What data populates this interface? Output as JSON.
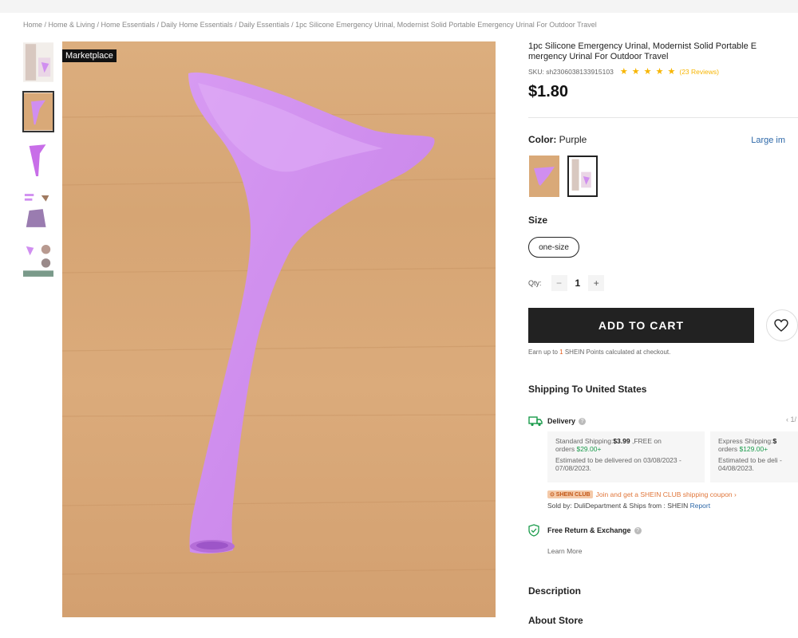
{
  "breadcrumb": "Home / Home & Living / Home Essentials / Daily Home Essentials / Daily Essentials / 1pc Silicone Emergency Urinal, Modernist Solid Portable Emergency Urinal For Outdoor Travel",
  "main_image": {
    "badge": "Marketplace"
  },
  "product": {
    "title": "1pc Silicone Emergency Urinal, Modernist Solid Portable E mergency Urinal For Outdoor Travel",
    "sku": "SKU: sh2306038133915103",
    "rating": 4.5,
    "stars": "★ ★ ★ ★ ★",
    "reviews": "(23 Reviews)",
    "price": "$1.80"
  },
  "color": {
    "label": "Color:",
    "value": "Purple",
    "large_image_link": "Large im"
  },
  "size": {
    "label": "Size",
    "option": "one-size"
  },
  "quantity": {
    "label": "Qty:",
    "minus": "−",
    "value": "1",
    "plus": "+"
  },
  "cart": {
    "add_label": "ADD TO CART"
  },
  "points": {
    "prefix": "Earn up to",
    "num": "1",
    "suffix": "SHEIN Points calculated at checkout."
  },
  "shipping": {
    "title": "Shipping To United States",
    "delivery_label": "Delivery",
    "pager": "‹ 1/",
    "standard": {
      "line1_prefix": "Standard Shipping:",
      "price": "$3.99",
      "line1_suffix": " ,FREE on",
      "line2_prefix": "orders ",
      "threshold": "$29.00+",
      "estimate": "Estimated to be delivered on 03/08/2023 - 07/08/2023."
    },
    "express": {
      "line1_prefix": "Express Shipping:",
      "price": "$",
      "line2_prefix": "orders ",
      "threshold": "$129.00+",
      "estimate": "Estimated to be deli - 04/08/2023."
    },
    "club_tag": "⊙ SHEIN CLUB",
    "club_text": "Join and get a SHEIN CLUB shipping coupon ›",
    "sold_by": "Sold by: DuliDepartment & Ships from : SHEIN",
    "report": "Report"
  },
  "returns": {
    "label": "Free Return & Exchange",
    "learn_more": "Learn More"
  },
  "sections": {
    "description": "Description",
    "about_store": "About Store"
  },
  "colors": {
    "product_purple": "#d08ef0",
    "price_text": "#111111",
    "button_bg": "#222222",
    "star": "#f7b500",
    "link": "#2d68a8",
    "green": "#1a9b4b"
  }
}
